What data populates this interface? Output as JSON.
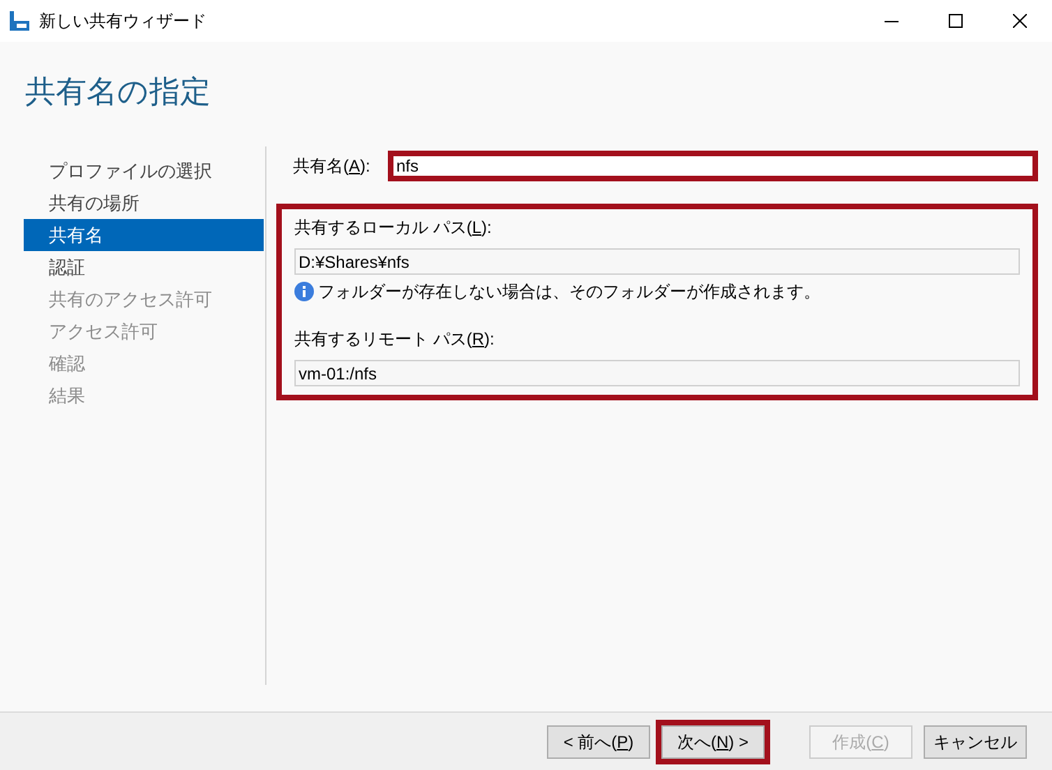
{
  "window": {
    "title": "新しい共有ウィザード"
  },
  "page_title": "共有名の指定",
  "nav": [
    {
      "label": "プロファイルの選択",
      "selected": false,
      "disabled": false
    },
    {
      "label": "共有の場所",
      "selected": false,
      "disabled": false
    },
    {
      "label": "共有名",
      "selected": true,
      "disabled": false
    },
    {
      "label": "認証",
      "selected": false,
      "disabled": false
    },
    {
      "label": "共有のアクセス許可",
      "selected": false,
      "disabled": true
    },
    {
      "label": "アクセス許可",
      "selected": false,
      "disabled": true
    },
    {
      "label": "確認",
      "selected": false,
      "disabled": true
    },
    {
      "label": "結果",
      "selected": false,
      "disabled": true
    }
  ],
  "share_name": {
    "label": [
      "共有名(",
      "A",
      "):"
    ],
    "value": "nfs",
    "highlighted": true
  },
  "paths_group": {
    "highlighted": true,
    "local_path": {
      "label": [
        "共有するローカル パス(",
        "L",
        "):"
      ],
      "value": "D:¥Shares¥nfs"
    },
    "info": "フォルダーが存在しない場合は、そのフォルダーが作成されます。",
    "remote_path": {
      "label": [
        "共有するリモート パス(",
        "R",
        "):"
      ],
      "value": "vm-01:/nfs"
    }
  },
  "buttons": [
    {
      "label": [
        "< 前へ(",
        "P",
        ")"
      ],
      "disabled": false,
      "highlighted": false
    },
    {
      "label": [
        "次へ(",
        "N",
        ") >"
      ],
      "disabled": false,
      "highlighted": true
    },
    {
      "label": [
        "作成(",
        "C",
        ")"
      ],
      "disabled": true,
      "highlighted": false
    },
    {
      "label": [
        "キャンセル"
      ],
      "disabled": false,
      "highlighted": false
    }
  ]
}
